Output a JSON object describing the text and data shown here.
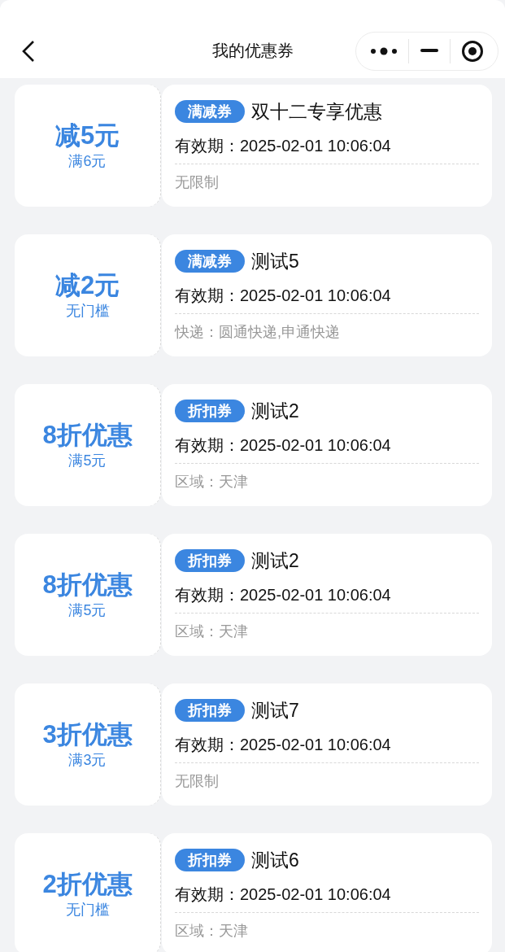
{
  "header": {
    "title": "我的优惠券"
  },
  "coupons": [
    {
      "amount": "减5元",
      "threshold": "满6元",
      "tag": "满减券",
      "name": "双十二专享优惠",
      "validity": "有效期：2025-02-01 10:06:04",
      "scope": "无限制"
    },
    {
      "amount": "减2元",
      "threshold": "无门槛",
      "tag": "满减券",
      "name": "测试5",
      "validity": "有效期：2025-02-01 10:06:04",
      "scope": "快递：圆通快递,申通快递"
    },
    {
      "amount": "8折优惠",
      "threshold": "满5元",
      "tag": "折扣券",
      "name": "测试2",
      "validity": "有效期：2025-02-01 10:06:04",
      "scope": "区域：天津"
    },
    {
      "amount": "8折优惠",
      "threshold": "满5元",
      "tag": "折扣券",
      "name": "测试2",
      "validity": "有效期：2025-02-01 10:06:04",
      "scope": "区域：天津"
    },
    {
      "amount": "3折优惠",
      "threshold": "满3元",
      "tag": "折扣券",
      "name": "测试7",
      "validity": "有效期：2025-02-01 10:06:04",
      "scope": "无限制"
    },
    {
      "amount": "2折优惠",
      "threshold": "无门槛",
      "tag": "折扣券",
      "name": "测试6",
      "validity": "有效期：2025-02-01 10:06:04",
      "scope": "区域：天津"
    }
  ]
}
